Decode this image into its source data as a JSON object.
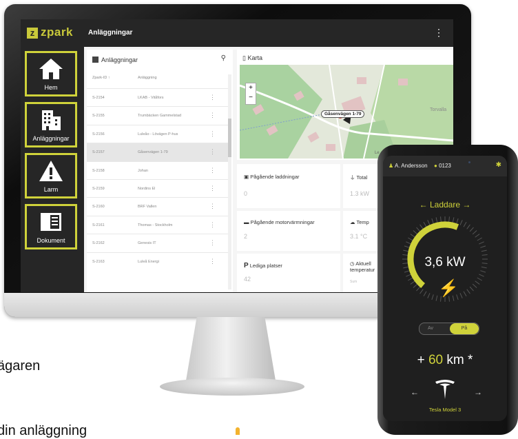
{
  "app": {
    "logo_mark": "z",
    "logo_text": "zpark",
    "title": "Anläggningar",
    "more_icon": "⋮"
  },
  "nav": {
    "items": [
      {
        "label": "Hem",
        "icon": "home-icon"
      },
      {
        "label": "Anläggningar",
        "icon": "building-icon"
      },
      {
        "label": "Larm",
        "icon": "warning-icon"
      },
      {
        "label": "Dokument",
        "icon": "document-icon"
      }
    ]
  },
  "list": {
    "title": "Anläggningar",
    "col_id": "Zpark-ID ↑",
    "col_name": "Anläggning",
    "rows": [
      {
        "id": "S-2154",
        "name": "LKAB - Vitåfors"
      },
      {
        "id": "S-2155",
        "name": "Trumbäcken Gammelstad"
      },
      {
        "id": "S-2156",
        "name": "Luleåo - Lövägen P-hus"
      },
      {
        "id": "S-2157",
        "name": "Gåsenvägen 1-79"
      },
      {
        "id": "S-2158",
        "name": "Johan"
      },
      {
        "id": "S-2159",
        "name": "Nordins El"
      },
      {
        "id": "S-2160",
        "name": "BRF Vallen"
      },
      {
        "id": "S-2161",
        "name": "Thomas - Stockholm"
      },
      {
        "id": "S-2162",
        "name": "Genesis IT"
      },
      {
        "id": "S-2163",
        "name": "Luleå Energi"
      }
    ]
  },
  "map": {
    "title": "Karta",
    "zoom_in": "+",
    "zoom_out": "−",
    "marker_label": "Gåsenvägen 1-79",
    "place_label": "Torvalla",
    "corner_label": "Le"
  },
  "tiles": {
    "charging": {
      "label": "Pågående laddningar",
      "value": "0"
    },
    "total": {
      "label": "Total",
      "value": "1.3 kW"
    },
    "heating": {
      "label": "Pågående motorvärmningar",
      "value": "2"
    },
    "temp": {
      "label": "Temp",
      "value": "3.1 °C"
    },
    "free": {
      "label": "Lediga platser",
      "value": "42"
    },
    "current_temp": {
      "label": "Aktuell temperatur",
      "value": "Sum"
    }
  },
  "phone": {
    "user": "A. Andersson",
    "code": "0123",
    "nav_label": "←  Laddare  →",
    "power": "3,6 kW",
    "toggle_off": "Av",
    "toggle_on": "På",
    "range_prefix": "+ ",
    "range_number": "60",
    "range_suffix": " km *",
    "car": "Tesla Model 3",
    "arrow_left": "←",
    "arrow_right": "→",
    "charge_fraction": 0.45
  },
  "side_text": {
    "line1": "ägaren",
    "line2": "din anläggning"
  },
  "colors": {
    "accent": "#cfd23a",
    "dark": "#262626"
  }
}
